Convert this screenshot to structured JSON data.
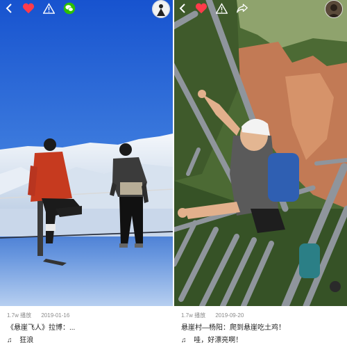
{
  "left": {
    "views": "1.7w 播放",
    "date": "2019-01-16",
    "title": "《悬崖飞人》拉博：...",
    "music": "狂浪",
    "icons": [
      "back-icon",
      "heart-icon",
      "warning-icon",
      "wechat-icon"
    ]
  },
  "right": {
    "views": "1.7w 播放",
    "date": "2019-09-20",
    "title": "悬崖村—杨阳：爬到悬崖吃土鸡！",
    "music": "哇，好漂亮啊！",
    "icons": [
      "back-icon",
      "heart-icon",
      "warning-icon",
      "share-icon"
    ]
  },
  "colors": {
    "heart": "#ff3b4a",
    "wechat": "#2dc100",
    "sky": "#1f62d6"
  },
  "music_symbol": "♫"
}
